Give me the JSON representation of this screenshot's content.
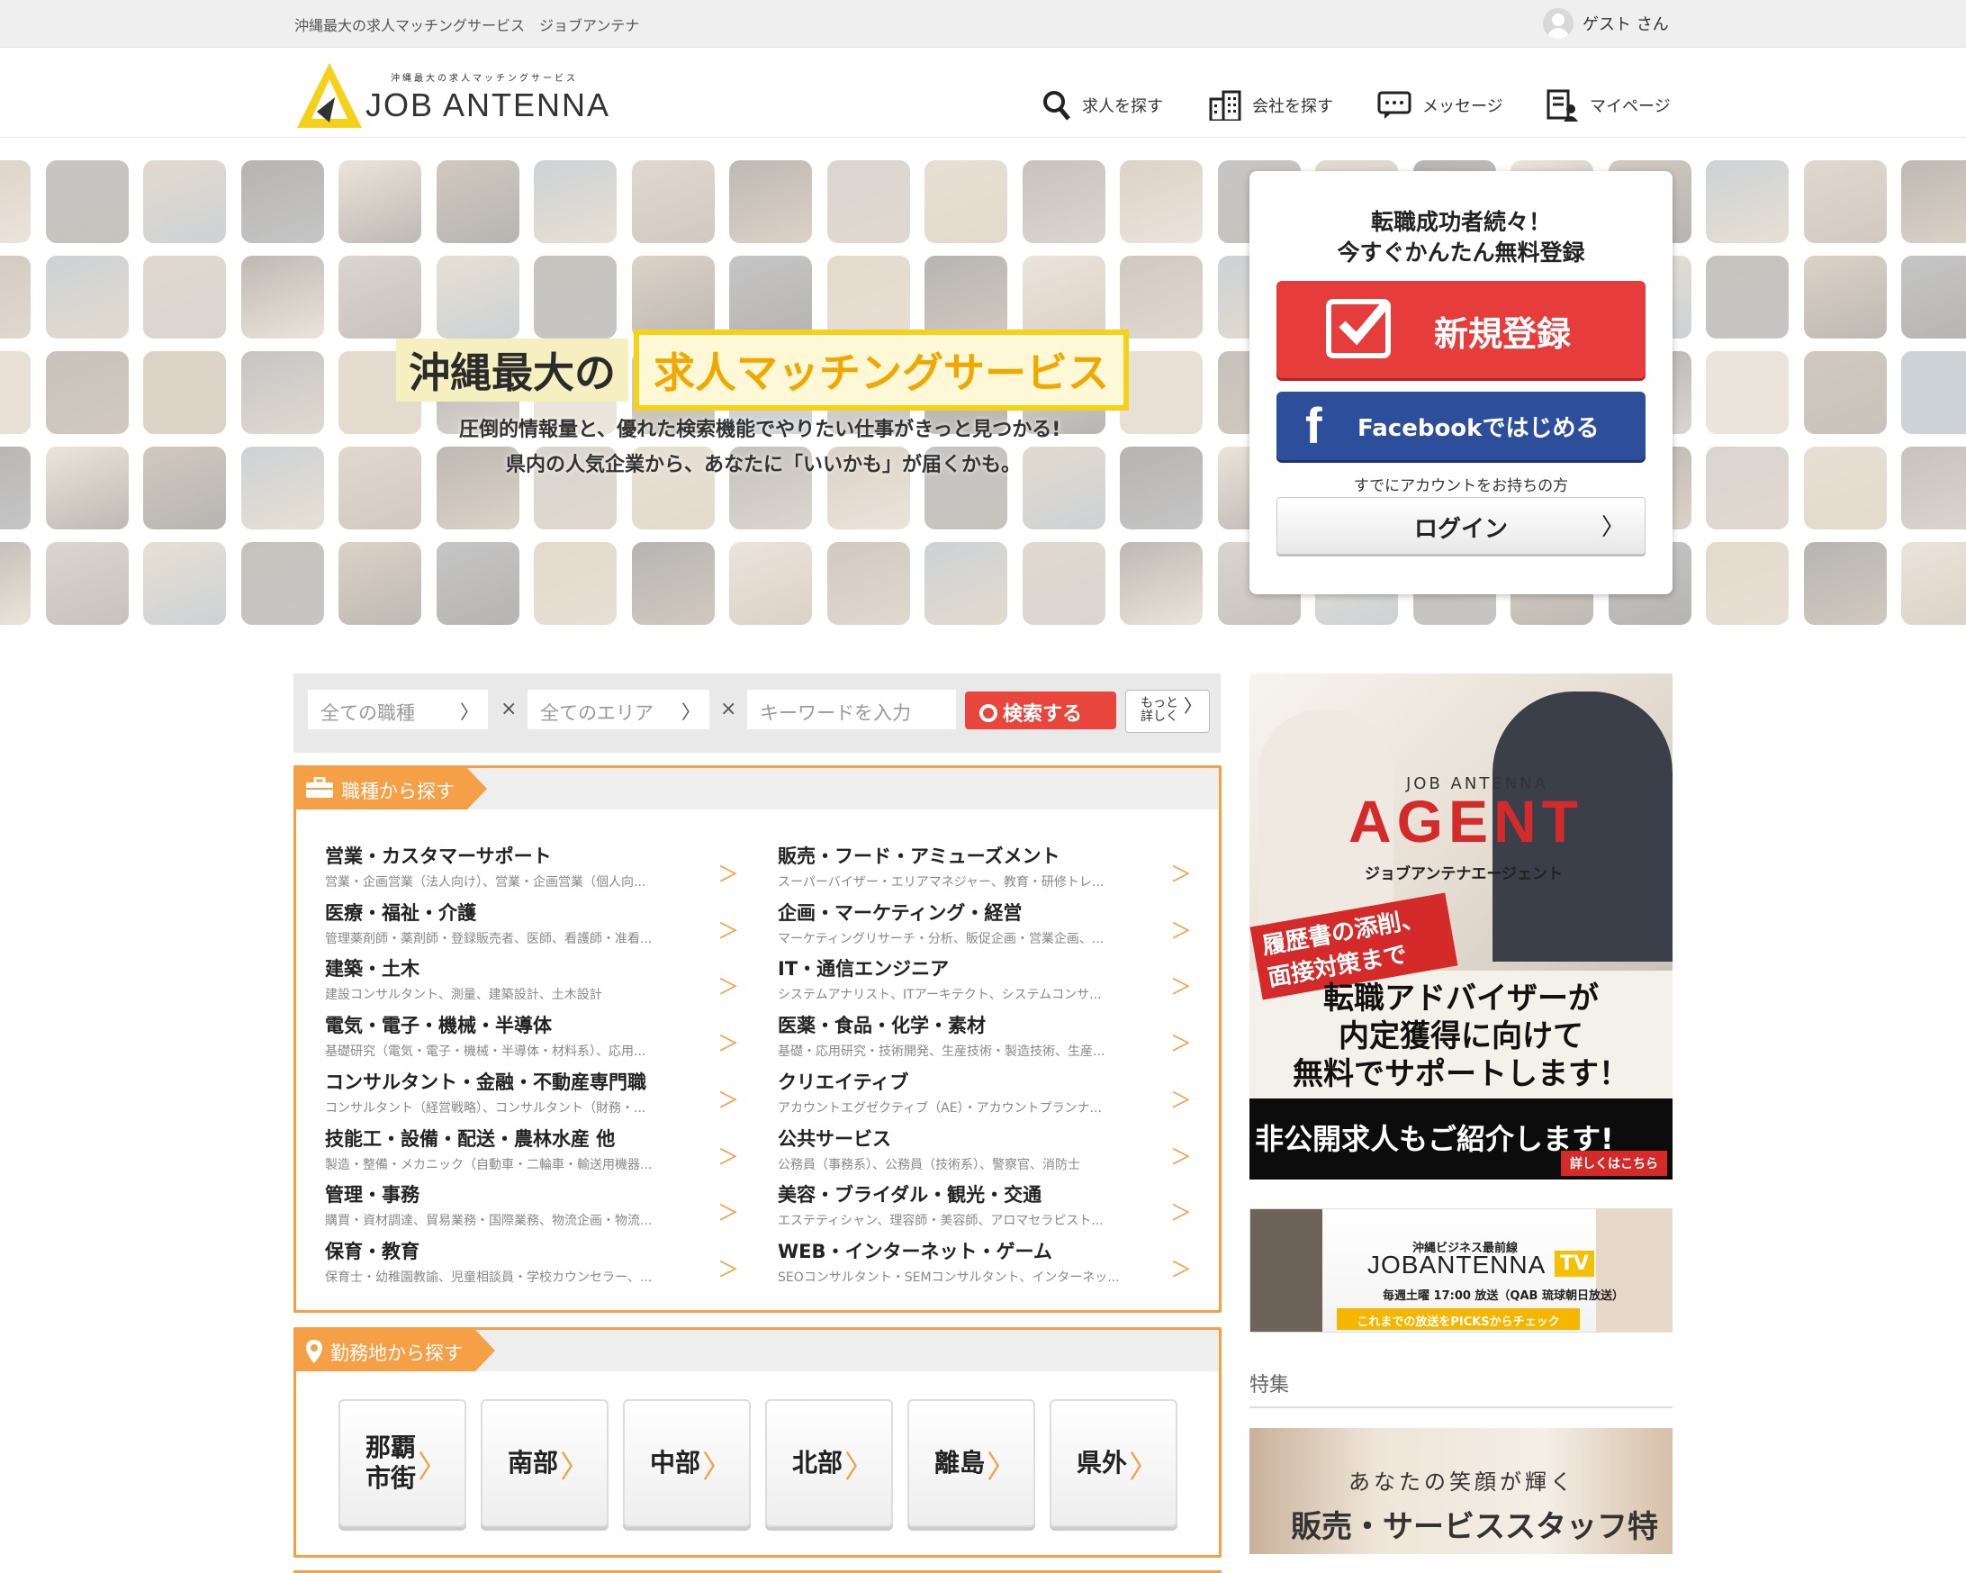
{
  "topbar": {
    "tagline": "沖縄最大の求人マッチングサービス　ジョブアンテナ",
    "user": "ゲスト さん"
  },
  "logo": {
    "sub": "沖縄最大の求人マッチングサービス",
    "name": "JOB ANTENNA"
  },
  "nav": [
    {
      "label": "求人を探す",
      "icon": "search-icon"
    },
    {
      "label": "会社を探す",
      "icon": "building-icon"
    },
    {
      "label": "メッセージ",
      "icon": "chat-icon"
    },
    {
      "label": "マイページ",
      "icon": "profile-icon"
    }
  ],
  "hero": {
    "title_a": "沖縄最大の",
    "title_b": "求人マッチングサービス",
    "sub1": "圧倒的情報量と、優れた検索機能でやりたい仕事がきっと見つかる!",
    "sub2": "県内の人気企業から、あなたに「いいかも」が届くかも。"
  },
  "signup": {
    "msg1": "転職成功者続々！",
    "msg2": "今すぐかんたん無料登録",
    "register": "新規登録",
    "facebook": "Facebookではじめる",
    "have_account": "すでにアカウントをお持ちの方",
    "login": "ログイン",
    "chevron": "〉"
  },
  "search": {
    "job_type": "全ての職種",
    "area": "全てのエリア",
    "keyword_placeholder": "キーワードを入力",
    "search_btn": "検索する",
    "more1": "もっと",
    "more2": "詳しく",
    "times": "×",
    "chevron": "〉"
  },
  "job_panel": {
    "title": "職種から探す",
    "chevron": "＞",
    "left": [
      {
        "title": "営業・カスタマーサポート",
        "desc": "営業・企画営業（法人向け）、営業・企画営業（個人向..."
      },
      {
        "title": "医療・福祉・介護",
        "desc": "管理薬剤師・薬剤師・登録販売者、医師、看護師・准看..."
      },
      {
        "title": "建築・土木",
        "desc": "建設コンサルタント、測量、建築設計、土木設計"
      },
      {
        "title": "電気・電子・機械・半導体",
        "desc": "基礎研究（電気・電子・機械・半導体・材料系）、応用..."
      },
      {
        "title": "コンサルタント・金融・不動産専門職",
        "desc": "コンサルタント（経営戦略）、コンサルタント（財務・..."
      },
      {
        "title": "技能工・設備・配送・農林水産 他",
        "desc": "製造・整備・メカニック（自動車・二輪車・輸送用機器..."
      },
      {
        "title": "管理・事務",
        "desc": "購買・資材調達、貿易業務・国際業務、物流企画・物流..."
      },
      {
        "title": "保育・教育",
        "desc": "保育士・幼稚園教諭、児童相談員・学校カウンセラー、..."
      }
    ],
    "right": [
      {
        "title": "販売・フード・アミューズメント",
        "desc": "スーパーバイザー・エリアマネジャー、教育・研修トレ..."
      },
      {
        "title": "企画・マーケティング・経営",
        "desc": "マーケティングリサーチ・分析、販促企画・営業企画、..."
      },
      {
        "title": "IT・通信エンジニア",
        "desc": "システムアナリスト、ITアーキテクト、システムコンサ..."
      },
      {
        "title": "医薬・食品・化学・素材",
        "desc": "基礎・応用研究・技術開発、生産技術・製造技術、生産..."
      },
      {
        "title": "クリエイティブ",
        "desc": "アカウントエグゼクティブ（AE）・アカウントプランナ..."
      },
      {
        "title": "公共サービス",
        "desc": "公務員（事務系）、公務員（技術系）、警察官、消防士"
      },
      {
        "title": "美容・ブライダル・観光・交通",
        "desc": "エステティシャン、理容師・美容師、アロマセラピスト..."
      },
      {
        "title": "WEB・インターネット・ゲーム",
        "desc": "SEOコンサルタント・SEMコンサルタント、インターネッ..."
      }
    ]
  },
  "area_panel": {
    "title": "勤務地から探す",
    "chevron": "〉",
    "areas": [
      [
        "那覇",
        "市街"
      ],
      [
        "南部"
      ],
      [
        "中部"
      ],
      [
        "北部"
      ],
      [
        "離島"
      ],
      [
        "県外"
      ]
    ]
  },
  "agent_banner": {
    "ja": "JOB ANTENNA",
    "agent": "AGENT",
    "kana": "ジョブアンテナエージェント",
    "red1": "履歴書の添削、",
    "red2": "面接対策まで",
    "copy1": "転職アドバイザーが",
    "copy2": "内定獲得に向けて",
    "copy3": "無料でサポートします！",
    "black": "非公開求人もご紹介します!",
    "detail": "詳しくはこちら"
  },
  "tv_banner": {
    "s1": "沖縄ビジネス最前線",
    "s2": "JOBANTENNA",
    "tv": "TV",
    "s3": "毎週土曜 17:00 放送（QAB 琉球朝日放送）",
    "bar": "これまでの放送をPICKSからチェック"
  },
  "special": {
    "title": "特集",
    "t1": "あなたの笑顔が輝く",
    "t2": "販売・サービススタッフ特集"
  },
  "colors": {
    "accent": "#f5a046",
    "register": "#e63c3c",
    "facebook": "#2c4e9b",
    "search": "#e8453c",
    "yellow": "#f4d21c"
  }
}
